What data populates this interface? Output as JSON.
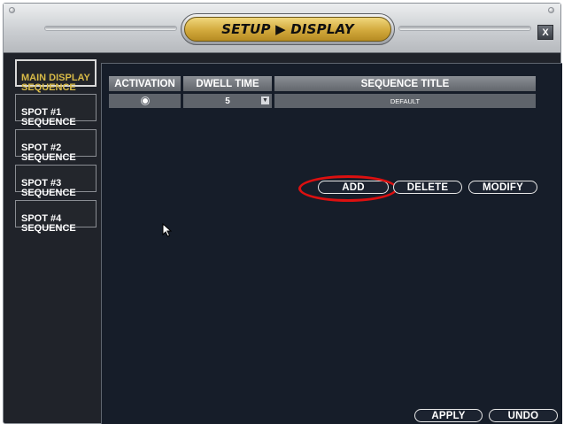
{
  "header": {
    "title": "SETUP ▶ DISPLAY",
    "close_label": "X"
  },
  "sidebar": {
    "items": [
      {
        "label": "MAIN DISPLAY\nSEQUENCE",
        "active": true
      },
      {
        "label": "SPOT #1\nSEQUENCE",
        "active": false
      },
      {
        "label": "SPOT #2\nSEQUENCE",
        "active": false
      },
      {
        "label": "SPOT #3\nSEQUENCE",
        "active": false
      },
      {
        "label": "SPOT #4\nSEQUENCE",
        "active": false
      }
    ]
  },
  "table": {
    "columns": [
      "ACTIVATION",
      "DWELL TIME",
      "SEQUENCE TITLE"
    ],
    "rows": [
      {
        "activation": "selected",
        "dwell_time": "5",
        "title": "DEFAULT"
      }
    ]
  },
  "actions": {
    "add": "ADD",
    "delete": "DELETE",
    "modify": "MODIFY"
  },
  "footer": {
    "apply": "APPLY",
    "undo": "UNDO"
  },
  "colors": {
    "accent_gold": "#d2a93c",
    "active_text": "#d8ba47",
    "highlight": "#dc1010",
    "panel_bg": "#161d29"
  },
  "icons": {
    "close": "close-icon",
    "dropdown": "triangle-down-icon",
    "cursor": "mouse-pointer-icon"
  }
}
